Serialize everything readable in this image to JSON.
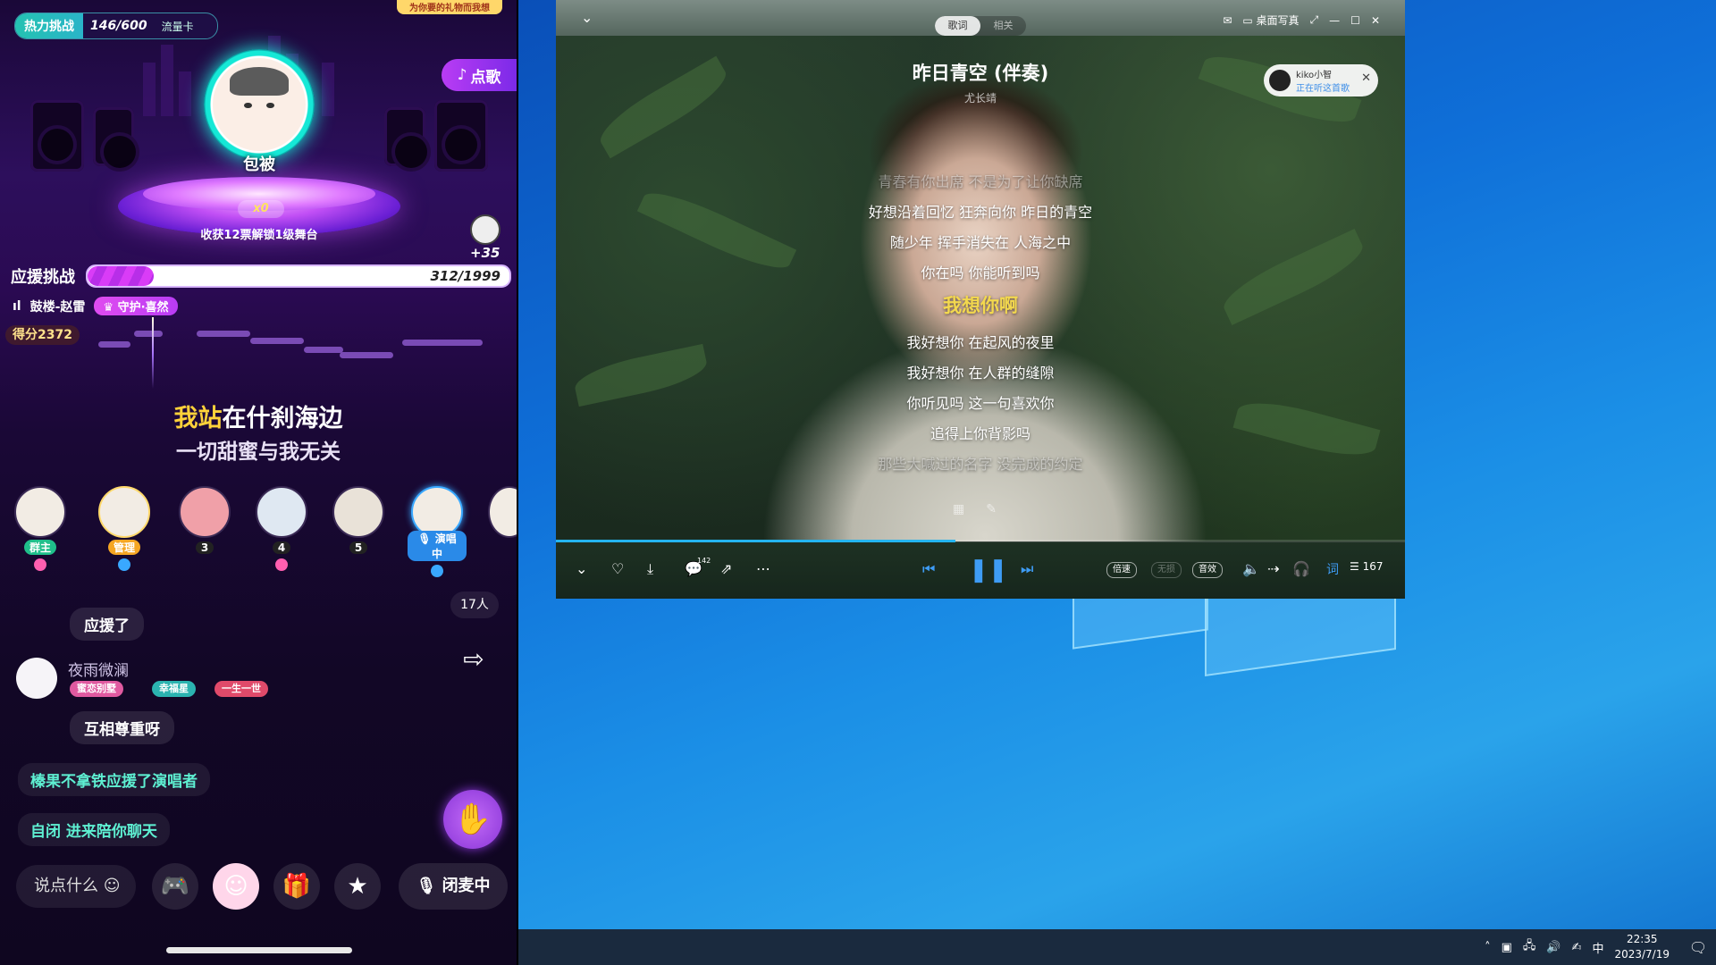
{
  "phone": {
    "heat": {
      "label": "热力挑战",
      "count": "146/600",
      "card": "流量卡"
    },
    "top_banner": "为你要的礼物而我想",
    "song_request": "点歌",
    "singer_name": "包被",
    "zero_badge": "x0",
    "unlock_text": "收获12票解锁1级舞台",
    "plus_points": "+35",
    "support": {
      "label": "应援挑战",
      "value": "312/1999",
      "progress": 0.156
    },
    "guard": {
      "name": "鼓楼-赵雷",
      "badge": "守护·喜然"
    },
    "score": "得分2372",
    "lyric_line1_highlight": "我站",
    "lyric_line1_rest": "在什刹海边",
    "lyric_line2": "一切甜蜜与我无关",
    "seats": [
      {
        "badge": "群主",
        "gem_color": "#ff5fb0"
      },
      {
        "badge": "管理",
        "gem_color": "#39a8ff"
      },
      {
        "badge": "3",
        "gem_color": ""
      },
      {
        "badge": "4",
        "gem_color": "#ff5fb0"
      },
      {
        "badge": "5",
        "gem_color": ""
      },
      {
        "badge": "演唱中",
        "gem_color": "#39a8ff"
      }
    ],
    "online_count": "17人",
    "chat": [
      {
        "text": "应援了"
      },
      {
        "name": "夜雨微澜",
        "tags": [
          "蜜恋别墅",
          "幸福星",
          "一生一世"
        ],
        "text": "互相尊重呀"
      }
    ],
    "system_msgs": [
      "榛果不拿铁应援了演唱者",
      "自闭 进来陪你聊天"
    ],
    "say_placeholder": "说点什么",
    "mic_off": "闭麦中"
  },
  "player": {
    "tabs": [
      "歌词",
      "相关"
    ],
    "desktop_lyrics": "桌面写真",
    "title": "昨日青空 (伴奏)",
    "artist": "尤长靖",
    "listener": {
      "name": "kiko小智",
      "status": "正在听这首歌"
    },
    "lyrics": [
      {
        "text": "青春有你出席 不是为了让你缺席",
        "state": "faded"
      },
      {
        "text": "好想沿着回忆 狂奔向你 昨日的青空",
        "state": "normal"
      },
      {
        "text": "随少年 挥手消失在 人海之中",
        "state": "normal"
      },
      {
        "text": "你在吗 你能听到吗",
        "state": "normal"
      },
      {
        "text": "我想你啊",
        "state": "current"
      },
      {
        "text": "我好想你 在起风的夜里",
        "state": "normal"
      },
      {
        "text": "我好想你 在人群的缝隙",
        "state": "normal"
      },
      {
        "text": "你听见吗 这一句喜欢你",
        "state": "normal"
      },
      {
        "text": "追得上你背影吗",
        "state": "normal"
      },
      {
        "text": "那些大喊过的名字 没完成的约定",
        "state": "faded"
      }
    ],
    "progress": 0.47,
    "comment_count": "142",
    "pill_speed": "倍速",
    "pill_pure": "无损",
    "pill_effect": "音效",
    "lyric_toggle": "词",
    "playlist_count": "167",
    "accent": "#3e9cf5"
  },
  "taskbar": {
    "ime": "中",
    "time": "22:35",
    "date": "2023/7/19"
  }
}
